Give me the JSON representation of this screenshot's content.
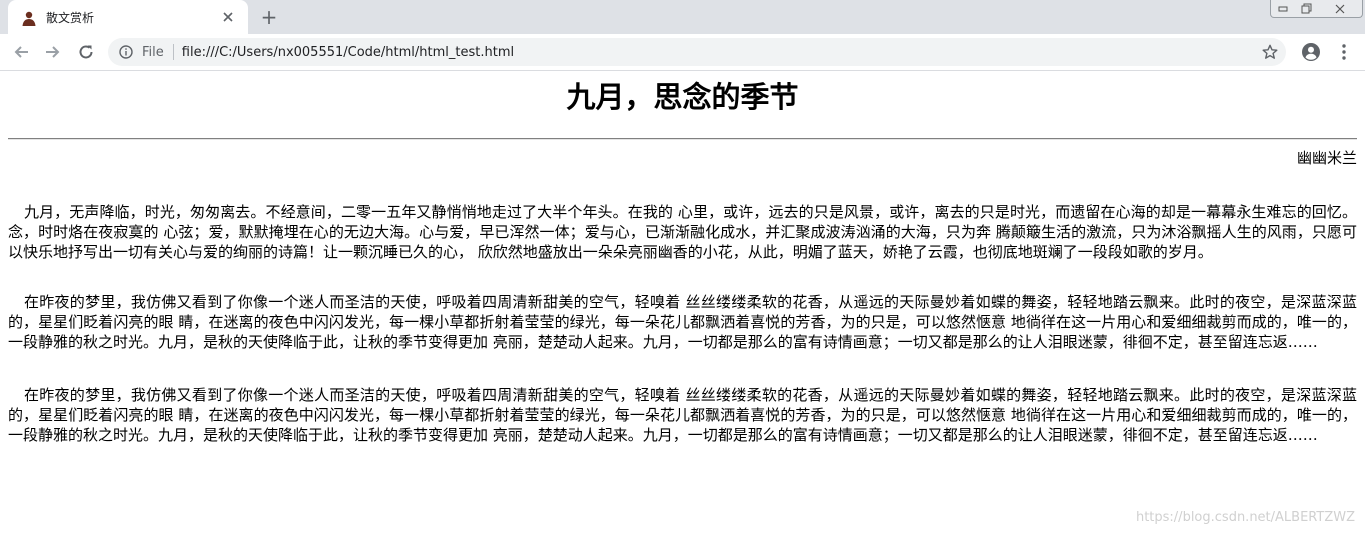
{
  "browser": {
    "tab": {
      "title": "散文赏析",
      "favicon": "person-silhouette-icon"
    },
    "new_tab_label": "+",
    "window_controls": [
      "minimize-icon",
      "restore-icon",
      "close-icon"
    ],
    "omnibox": {
      "scheme_label": "File",
      "url": "file:///C:/Users/nx005551/Code/html/html_test.html"
    }
  },
  "page": {
    "title": "九月，思念的季节",
    "author": "幽幽米兰",
    "paragraphs": [
      "九月，无声降临，时光，匆匆离去。不经意间，二零一五年又静悄悄地走过了大半个年头。在我的 心里，或许，远去的只是风景，或许，离去的只是时光，而遗留在心海的却是一幕幕永生难忘的回忆。念，时时烙在夜寂寞的 心弦；爱，默默掩埋在心的无边大海。心与爱，早已浑然一体；爱与心，已渐渐融化成水，并汇聚成波涛汹涌的大海，只为奔 腾颠簸生活的激流，只为沐浴飘摇人生的风雨，只愿可以快乐地抒写出一切有关心与爱的绚丽的诗篇！让一颗沉睡已久的心， 欣欣然地盛放出一朵朵亮丽幽香的小花，从此，明媚了蓝天，娇艳了云霞，也彻底地斑斓了一段段如歌的岁月。",
      "在昨夜的梦里，我仿佛又看到了你像一个迷人而圣洁的天使，呼吸着四周清新甜美的空气，轻嗅着 丝丝缕缕柔软的花香，从遥远的天际曼妙着如蝶的舞姿，轻轻地踏云飘来。此时的夜空，是深蓝深蓝的，星星们眨着闪亮的眼 睛，在迷离的夜色中闪闪发光，每一棵小草都折射着莹莹的绿光，每一朵花儿都飘洒着喜悦的芳香，为的只是，可以悠然惬意 地徜徉在这一片用心和爱细细裁剪而成的，唯一的，一段静雅的秋之时光。九月，是秋的天使降临于此，让秋的季节变得更加 亮丽，楚楚动人起来。九月，一切都是那么的富有诗情画意；一切又都是那么的让人泪眼迷蒙，徘徊不定，甚至留连忘返……",
      "在昨夜的梦里，我仿佛又看到了你像一个迷人而圣洁的天使，呼吸着四周清新甜美的空气，轻嗅着 丝丝缕缕柔软的花香，从遥远的天际曼妙着如蝶的舞姿，轻轻地踏云飘来。此时的夜空，是深蓝深蓝的，星星们眨着闪亮的眼 睛，在迷离的夜色中闪闪发光，每一棵小草都折射着莹莹的绿光，每一朵花儿都飘洒着喜悦的芳香，为的只是，可以悠然惬意 地徜徉在这一片用心和爱细细裁剪而成的，唯一的，一段静雅的秋之时光。九月，是秋的天使降临于此，让秋的季节变得更加 亮丽，楚楚动人起来。九月，一切都是那么的富有诗情画意；一切又都是那么的让人泪眼迷蒙，徘徊不定，甚至留连忘返……"
    ],
    "watermark": "https://blog.csdn.net/ALBERTZWZ"
  }
}
